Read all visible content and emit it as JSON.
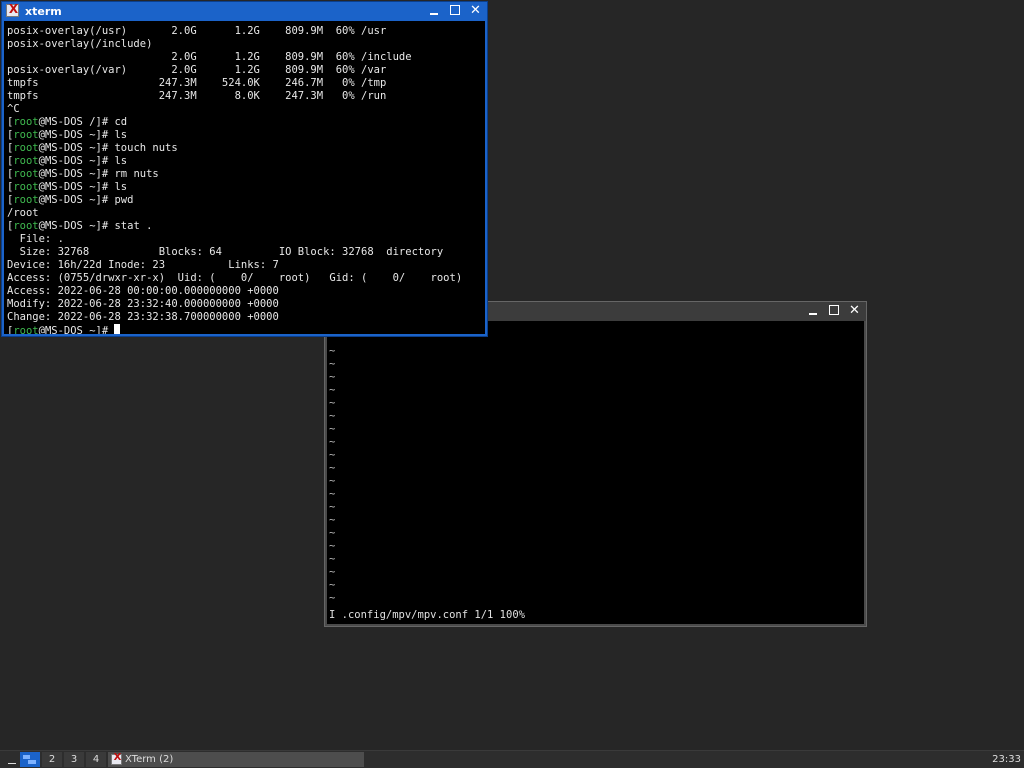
{
  "xterm": {
    "title": "xterm",
    "lines": [
      {
        "t": "posix-overlay(/usr)       2.0G      1.2G    809.9M  60% /usr"
      },
      {
        "t": "posix-overlay(/include)"
      },
      {
        "t": "                          2.0G      1.2G    809.9M  60% /include"
      },
      {
        "t": "posix-overlay(/var)       2.0G      1.2G    809.9M  60% /var"
      },
      {
        "t": "tmpfs                   247.3M    524.0K    246.7M   0% /tmp"
      },
      {
        "t": "tmpfs                   247.3M      8.0K    247.3M   0% /run"
      },
      {
        "t": "^C"
      },
      {
        "p": "/",
        "c": "cd"
      },
      {
        "p": "~",
        "c": "ls"
      },
      {
        "p": "~",
        "c": "touch nuts"
      },
      {
        "p": "~",
        "c": "ls"
      },
      {
        "p": "~",
        "c": "rm nuts"
      },
      {
        "p": "~",
        "c": "ls"
      },
      {
        "p": "~",
        "c": "pwd"
      },
      {
        "t": "/root"
      },
      {
        "p": "~",
        "c": "stat ."
      },
      {
        "t": "  File: ."
      },
      {
        "t": "  Size: 32768           Blocks: 64         IO Block: 32768  directory"
      },
      {
        "t": "Device: 16h/22d Inode: 23          Links: 7"
      },
      {
        "t": "Access: (0755/drwxr-xr-x)  Uid: (    0/    root)   Gid: (    0/    root)"
      },
      {
        "t": "Access: 2022-06-28 00:00:00.000000000 +0000"
      },
      {
        "t": "Modify: 2022-06-28 23:32:40.000000000 +0000"
      },
      {
        "t": "Change: 2022-06-28 23:32:38.700000000 +0000"
      },
      {
        "p": "~",
        "c": "",
        "cursor": true
      }
    ],
    "prompt_user": "root",
    "prompt_host": "MS-DOS"
  },
  "vim": {
    "tilde": "~",
    "tilde_count": 20,
    "status": "I .config/mpv/mpv.conf 1/1 100%"
  },
  "taskbar": {
    "workspaces": [
      "",
      "2",
      "3",
      "4"
    ],
    "active_workspace": 0,
    "task_label": "XTerm (2)",
    "clock": "23:33"
  },
  "colors": {
    "active_titlebar": "#1b63c9",
    "prompt_user": "#3fb94f",
    "desktop": "#262626"
  }
}
